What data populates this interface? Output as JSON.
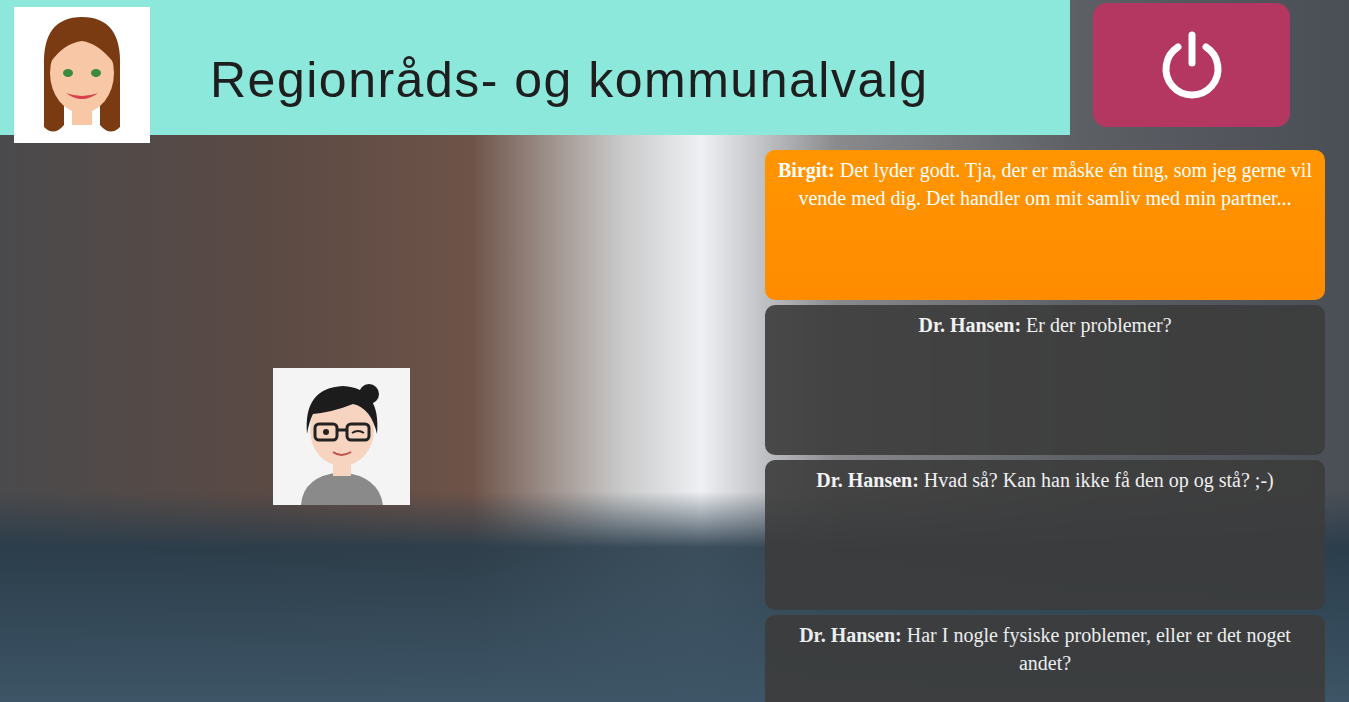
{
  "header": {
    "title": "Regionråds- og kommunalvalg"
  },
  "chat": [
    {
      "speaker": "Birgit:",
      "text": "Det lyder godt. Tja, der er måske én ting, som jeg gerne vil vende med dig. Det handler om mit samliv med min partner...",
      "color": "#ff9500"
    },
    {
      "speaker": "Dr. Hansen:",
      "text": "Er der problemer?",
      "color": "#3c3c3c"
    },
    {
      "speaker": "Dr. Hansen:",
      "text": "Hvad så? Kan han ikke få den op og stå? ;-)",
      "color": "#3c3c3c"
    },
    {
      "speaker": "Dr. Hansen:",
      "text": "Har I nogle fysiske problemer, eller er det noget andet?",
      "color": "#3c3c3c"
    }
  ]
}
